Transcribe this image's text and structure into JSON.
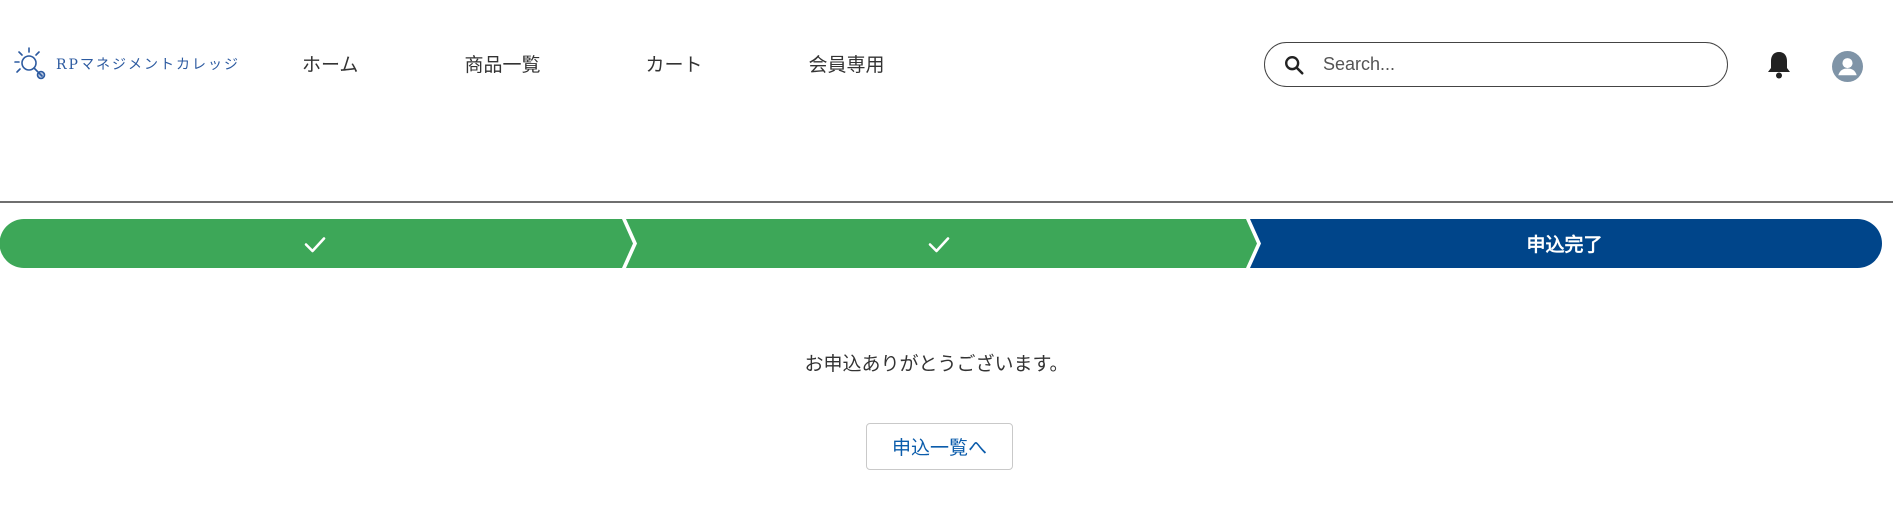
{
  "header": {
    "logo_text": "RPマネジメントカレッジ",
    "nav": [
      "ホーム",
      "商品一覧",
      "カート",
      "会員専用"
    ],
    "search_placeholder": "Search..."
  },
  "progress": {
    "steps": [
      {
        "status": "complete",
        "label": ""
      },
      {
        "status": "complete",
        "label": ""
      },
      {
        "status": "current",
        "label": "申込完了"
      }
    ],
    "colors": {
      "complete": "#3da758",
      "current": "#00458a"
    }
  },
  "main": {
    "message": "お申込ありがとうございます。",
    "button_label": "申込一覧へ"
  },
  "icons": [
    "logo-icon",
    "search-icon",
    "bell-icon",
    "user-avatar-icon",
    "check-icon"
  ]
}
